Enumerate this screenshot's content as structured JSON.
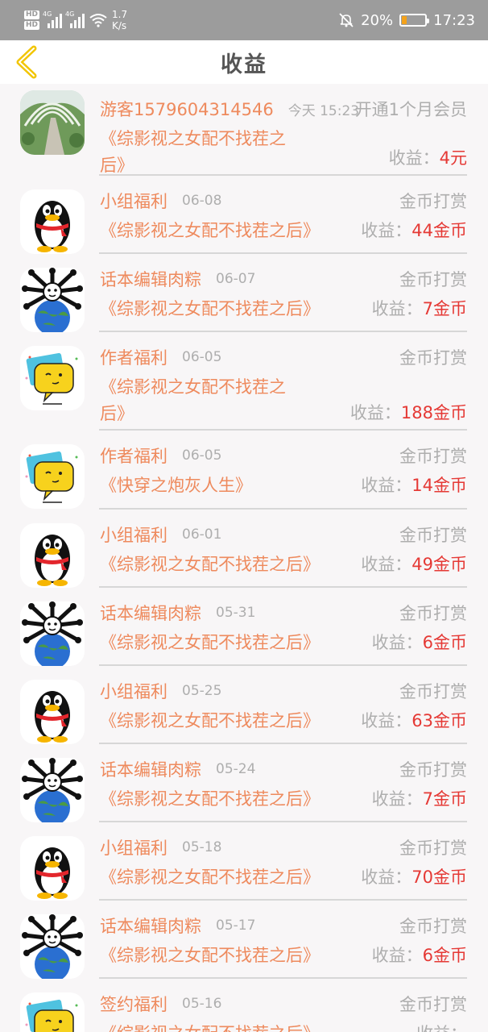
{
  "status_bar": {
    "network_badge_1": "HD",
    "network_badge_2": "HD",
    "network_gen_1": "4G",
    "network_gen_2": "4G",
    "speed_value": "1.7",
    "speed_unit": "K/s",
    "battery": "20%",
    "battery_level": 0.2,
    "time": "17:23",
    "icons": [
      "signal-icon",
      "wifi-icon",
      "mute-bell-icon",
      "battery-icon"
    ]
  },
  "header": {
    "title": "收益",
    "back_icon": "chevron-left-icon",
    "accent_color": "#f2c500"
  },
  "colors": {
    "name": "#ee8a5d",
    "muted": "#aeaeae",
    "amount": "#e53935"
  },
  "items": [
    {
      "name": "游客1579604314546",
      "date": "今天 15:23",
      "type": "开通1个月会员",
      "book": "《综影视之女配不找茬之后》",
      "earn_label": "收益：",
      "earn_amount": "4元",
      "avatar": "garden-photo"
    },
    {
      "name": "小组福利",
      "date": "06-08",
      "type": "金币打赏",
      "book": "《综影视之女配不找茬之后》",
      "earn_label": "收益：",
      "earn_amount": "44金币",
      "avatar": "penguin-avatar"
    },
    {
      "name": "话本编辑肉粽",
      "date": "06-07",
      "type": "金币打赏",
      "book": "《综影视之女配不找茬之后》",
      "earn_label": "收益：",
      "earn_amount": "7金币",
      "avatar": "globe-avatar"
    },
    {
      "name": "作者福利",
      "date": "06-05",
      "type": "金币打赏",
      "book": "《综影视之女配不找茬之后》",
      "earn_label": "收益：",
      "earn_amount": "188金币",
      "avatar": "chat-bubble-avatar"
    },
    {
      "name": "作者福利",
      "date": "06-05",
      "type": "金币打赏",
      "book": "《快穿之炮灰人生》",
      "earn_label": "收益：",
      "earn_amount": "14金币",
      "avatar": "chat-bubble-avatar"
    },
    {
      "name": "小组福利",
      "date": "06-01",
      "type": "金币打赏",
      "book": "《综影视之女配不找茬之后》",
      "earn_label": "收益：",
      "earn_amount": "49金币",
      "avatar": "penguin-avatar"
    },
    {
      "name": "话本编辑肉粽",
      "date": "05-31",
      "type": "金币打赏",
      "book": "《综影视之女配不找茬之后》",
      "earn_label": "收益：",
      "earn_amount": "6金币",
      "avatar": "globe-avatar"
    },
    {
      "name": "小组福利",
      "date": "05-25",
      "type": "金币打赏",
      "book": "《综影视之女配不找茬之后》",
      "earn_label": "收益：",
      "earn_amount": "63金币",
      "avatar": "penguin-avatar"
    },
    {
      "name": "话本编辑肉粽",
      "date": "05-24",
      "type": "金币打赏",
      "book": "《综影视之女配不找茬之后》",
      "earn_label": "收益：",
      "earn_amount": "7金币",
      "avatar": "globe-avatar"
    },
    {
      "name": "小组福利",
      "date": "05-18",
      "type": "金币打赏",
      "book": "《综影视之女配不找茬之后》",
      "earn_label": "收益：",
      "earn_amount": "70金币",
      "avatar": "penguin-avatar"
    },
    {
      "name": "话本编辑肉粽",
      "date": "05-17",
      "type": "金币打赏",
      "book": "《综影视之女配不找茬之后》",
      "earn_label": "收益：",
      "earn_amount": "6金币",
      "avatar": "globe-avatar"
    },
    {
      "name": "签约福利",
      "date": "05-16",
      "type": "金币打赏",
      "book": "《综影视之女配不找茬之后》",
      "earn_label": "收益：",
      "earn_amount": "",
      "avatar": "chat-bubble-avatar"
    }
  ]
}
